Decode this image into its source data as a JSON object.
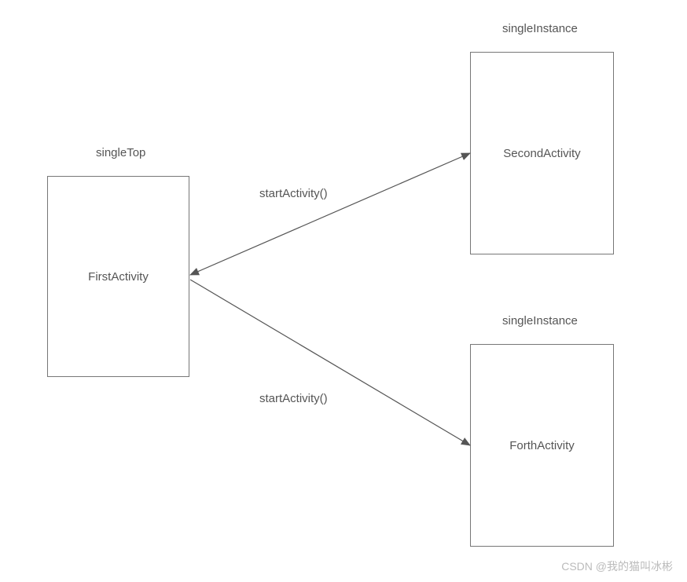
{
  "boxes": {
    "first": {
      "title": "singleTop",
      "label": "FirstActivity"
    },
    "second": {
      "title": "singleInstance",
      "label": "SecondActivity"
    },
    "forth": {
      "title": "singleInstance",
      "label": "ForthActivity"
    }
  },
  "arrows": {
    "toSecond": {
      "label": "startActivity()"
    },
    "toForth": {
      "label": "startActivity()"
    }
  },
  "watermark": "CSDN @我的猫叫冰彬",
  "colors": {
    "line": "#555555",
    "text": "#555555",
    "watermark": "#bbbbbb"
  }
}
